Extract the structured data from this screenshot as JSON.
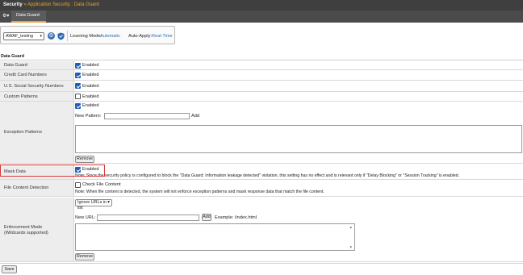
{
  "breadcrumb": {
    "root": "Security",
    "separator": "»",
    "path": "Application Security : Data Guard"
  },
  "tabs": {
    "active": "Data Guard"
  },
  "toolbar": {
    "policy": "AWAF_testing",
    "learning_mode_label": "Learning Mode:",
    "learning_mode_value": "Automatic",
    "auto_apply_label": "Auto-Apply:",
    "auto_apply_value": "Real-Time"
  },
  "section_title": "Data Guard",
  "rows": {
    "data_guard": {
      "label": "Data Guard",
      "checkbox": "Enabled",
      "checked": true
    },
    "credit_card": {
      "label": "Credit Card Numbers",
      "checkbox": "Enabled",
      "checked": true
    },
    "ssn": {
      "label": "U.S. Social Security Numbers",
      "checkbox": "Enabled",
      "checked": true
    },
    "custom_patterns": {
      "label": "Custom Patterns",
      "checkbox": "Enabled",
      "checked": false
    },
    "exception_patterns": {
      "label": "Exception Patterns",
      "checkbox": "Enabled",
      "checked": true,
      "new_pattern_label": "New Pattern:",
      "add_label": "Add",
      "remove_label": "Remove"
    },
    "mask_data": {
      "label": "Mask Data",
      "checkbox": "Enabled",
      "checked": true,
      "note": "Note: Since the security policy is configured to block the \"Data Guard: Information leakage detected\" violation, this setting has no effect and is relevant only if \"Delay Blocking\" or \"Session Tracking\" is enabled."
    },
    "file_content": {
      "label": "File Content Detection",
      "checkbox": "Check File Content",
      "checked": false,
      "note": "Note: When file content is detected, the system will not enforce exception patterns and mask response data that match the file content."
    },
    "enforcement": {
      "label_line1": "Enforcement Mode",
      "label_line2": "(Wildcards supported)",
      "select": "Ignore URLs in list",
      "new_url_label": "New URL:",
      "add_label": "Add",
      "example": "Example: /index.html",
      "remove_label": "Remove"
    }
  },
  "footer": {
    "save_label": "Save"
  },
  "colors": {
    "highlight": "#d63b3b",
    "accent": "#e8a430",
    "link": "#2d6db5",
    "checkbox": "#1f5fb8"
  }
}
